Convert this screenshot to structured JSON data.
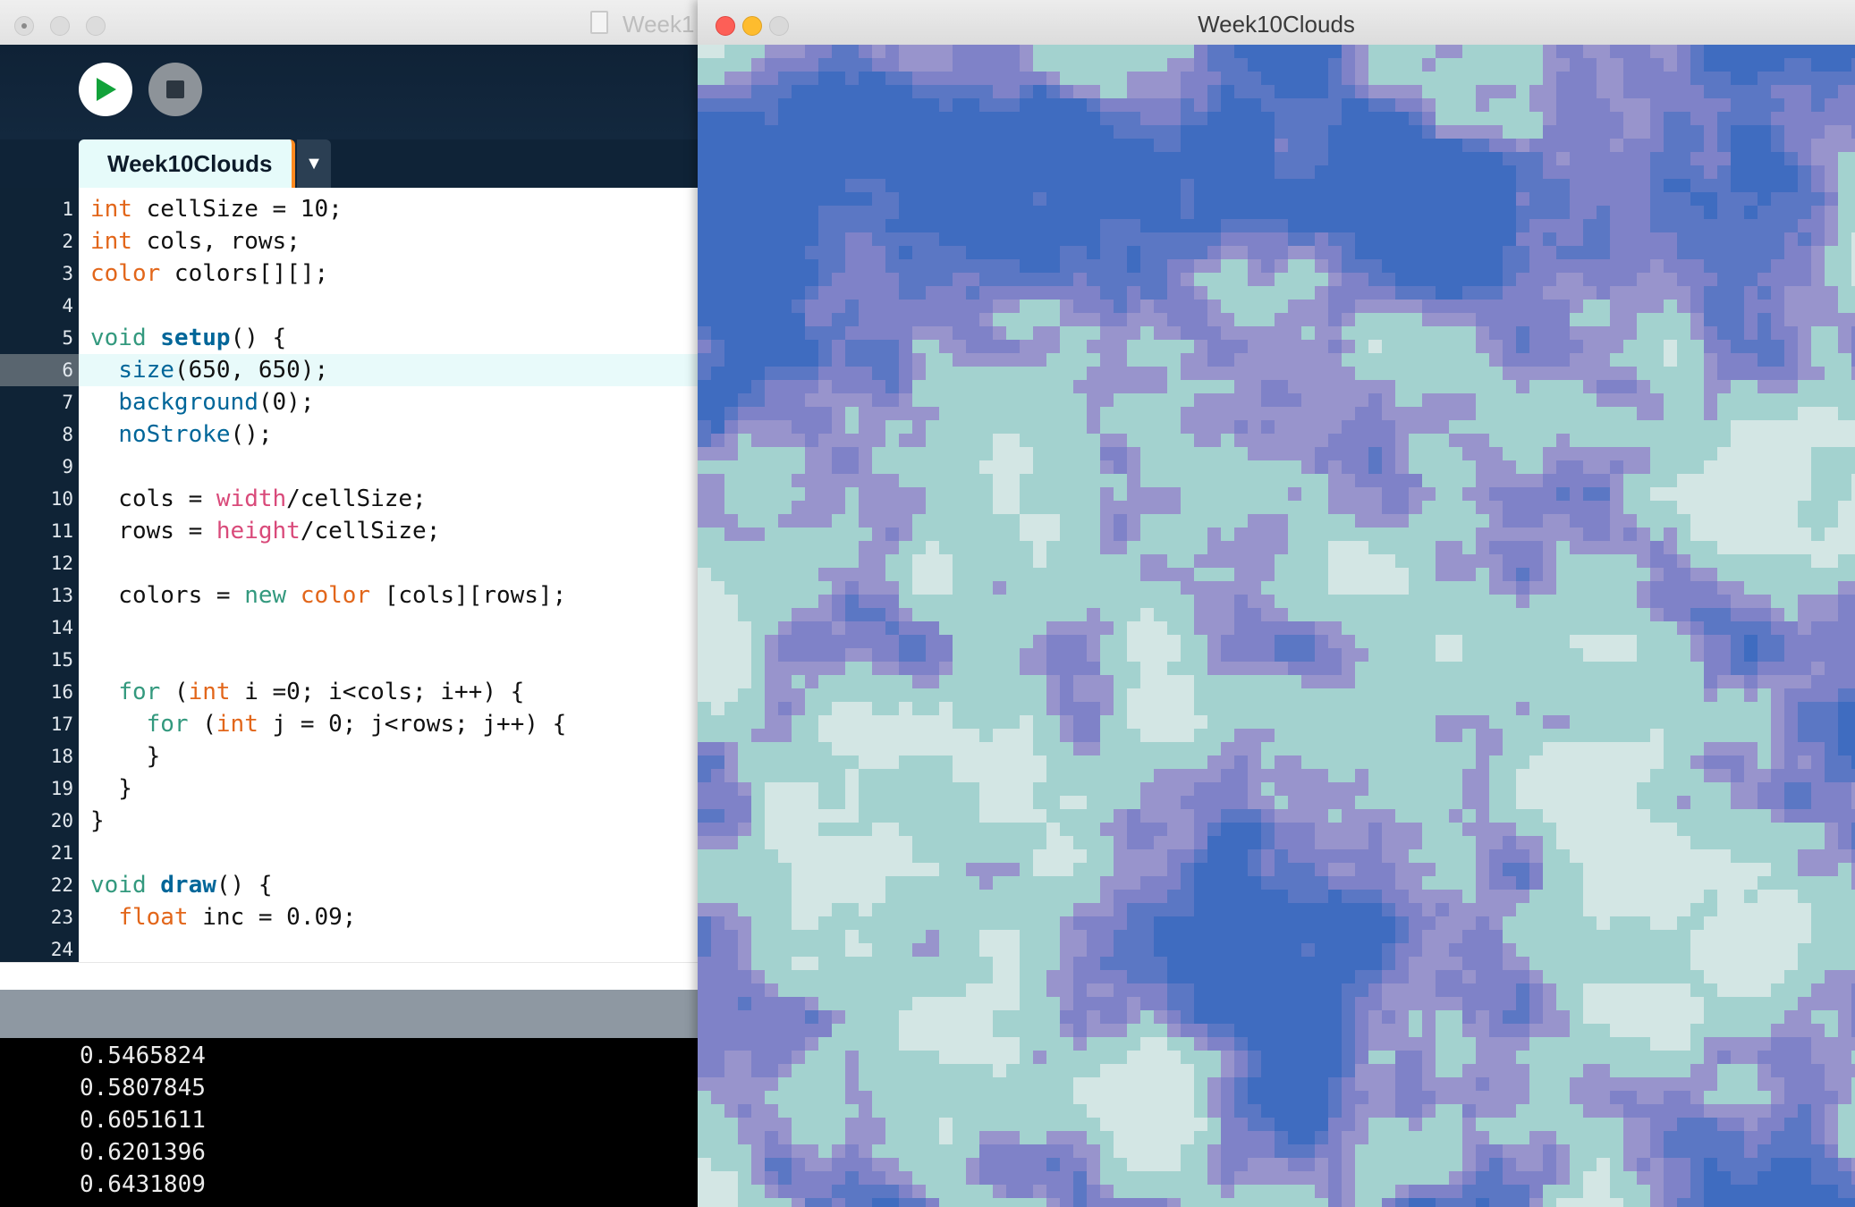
{
  "ide": {
    "title": "Week1",
    "tab_label": "Week10Clouds",
    "tab_arrow": "▼",
    "line_numbers": [
      "1",
      "2",
      "3",
      "4",
      "5",
      "6",
      "7",
      "8",
      "9",
      "10",
      "11",
      "12",
      "13",
      "14",
      "15",
      "16",
      "17",
      "18",
      "19",
      "20",
      "21",
      "22",
      "23",
      "24"
    ],
    "active_line": 6,
    "code": [
      [
        [
          "kw",
          "int"
        ],
        [
          "t",
          " cellSize = 10;"
        ]
      ],
      [
        [
          "kw",
          "int"
        ],
        [
          "t",
          " cols, rows;"
        ]
      ],
      [
        [
          "kw",
          "color"
        ],
        [
          "t",
          " colors[][];"
        ]
      ],
      [],
      [
        [
          "kw2",
          "void"
        ],
        [
          "t",
          " "
        ],
        [
          "fnb",
          "setup"
        ],
        [
          "t",
          "() {"
        ]
      ],
      [
        [
          "t",
          "  "
        ],
        [
          "fn",
          "size"
        ],
        [
          "t",
          "(650, 650);"
        ]
      ],
      [
        [
          "t",
          "  "
        ],
        [
          "fn",
          "background"
        ],
        [
          "t",
          "(0);"
        ]
      ],
      [
        [
          "t",
          "  "
        ],
        [
          "fn",
          "noStroke"
        ],
        [
          "t",
          "();"
        ]
      ],
      [],
      [
        [
          "t",
          "  cols = "
        ],
        [
          "pk",
          "width"
        ],
        [
          "t",
          "/cellSize;"
        ]
      ],
      [
        [
          "t",
          "  rows = "
        ],
        [
          "pk",
          "height"
        ],
        [
          "t",
          "/cellSize;"
        ]
      ],
      [],
      [
        [
          "t",
          "  colors = "
        ],
        [
          "kw2",
          "new"
        ],
        [
          "t",
          " "
        ],
        [
          "kw",
          "color"
        ],
        [
          "t",
          " [cols][rows];"
        ]
      ],
      [],
      [],
      [
        [
          "t",
          "  "
        ],
        [
          "kw2",
          "for"
        ],
        [
          "t",
          " ("
        ],
        [
          "kw",
          "int"
        ],
        [
          "t",
          " i =0; i<cols; i++) {"
        ]
      ],
      [
        [
          "t",
          "    "
        ],
        [
          "kw2",
          "for"
        ],
        [
          "t",
          " ("
        ],
        [
          "kw",
          "int"
        ],
        [
          "t",
          " j = 0; j<rows; j++) {"
        ]
      ],
      [
        [
          "t",
          "    }"
        ]
      ],
      [
        [
          "t",
          "  }"
        ]
      ],
      [
        [
          "t",
          "}"
        ]
      ],
      [],
      [
        [
          "kw2",
          "void"
        ],
        [
          "t",
          " "
        ],
        [
          "fnb",
          "draw"
        ],
        [
          "t",
          "() {"
        ]
      ],
      [
        [
          "t",
          "  "
        ],
        [
          "kw",
          "float"
        ],
        [
          "t",
          " inc = 0.09;"
        ]
      ],
      []
    ],
    "console_values": [
      "0.5465824",
      "0.5807845",
      "0.6051611",
      "0.6201396",
      "0.6431809"
    ]
  },
  "sketch": {
    "title": "Week10Clouds",
    "colors": {
      "light": "#d3e6e4",
      "teal": "#a3d2cf",
      "lavender": "#9894cc",
      "purple": "#7f82c8",
      "blue": "#5b77c4",
      "deep_blue": "#3f6cc0"
    }
  }
}
